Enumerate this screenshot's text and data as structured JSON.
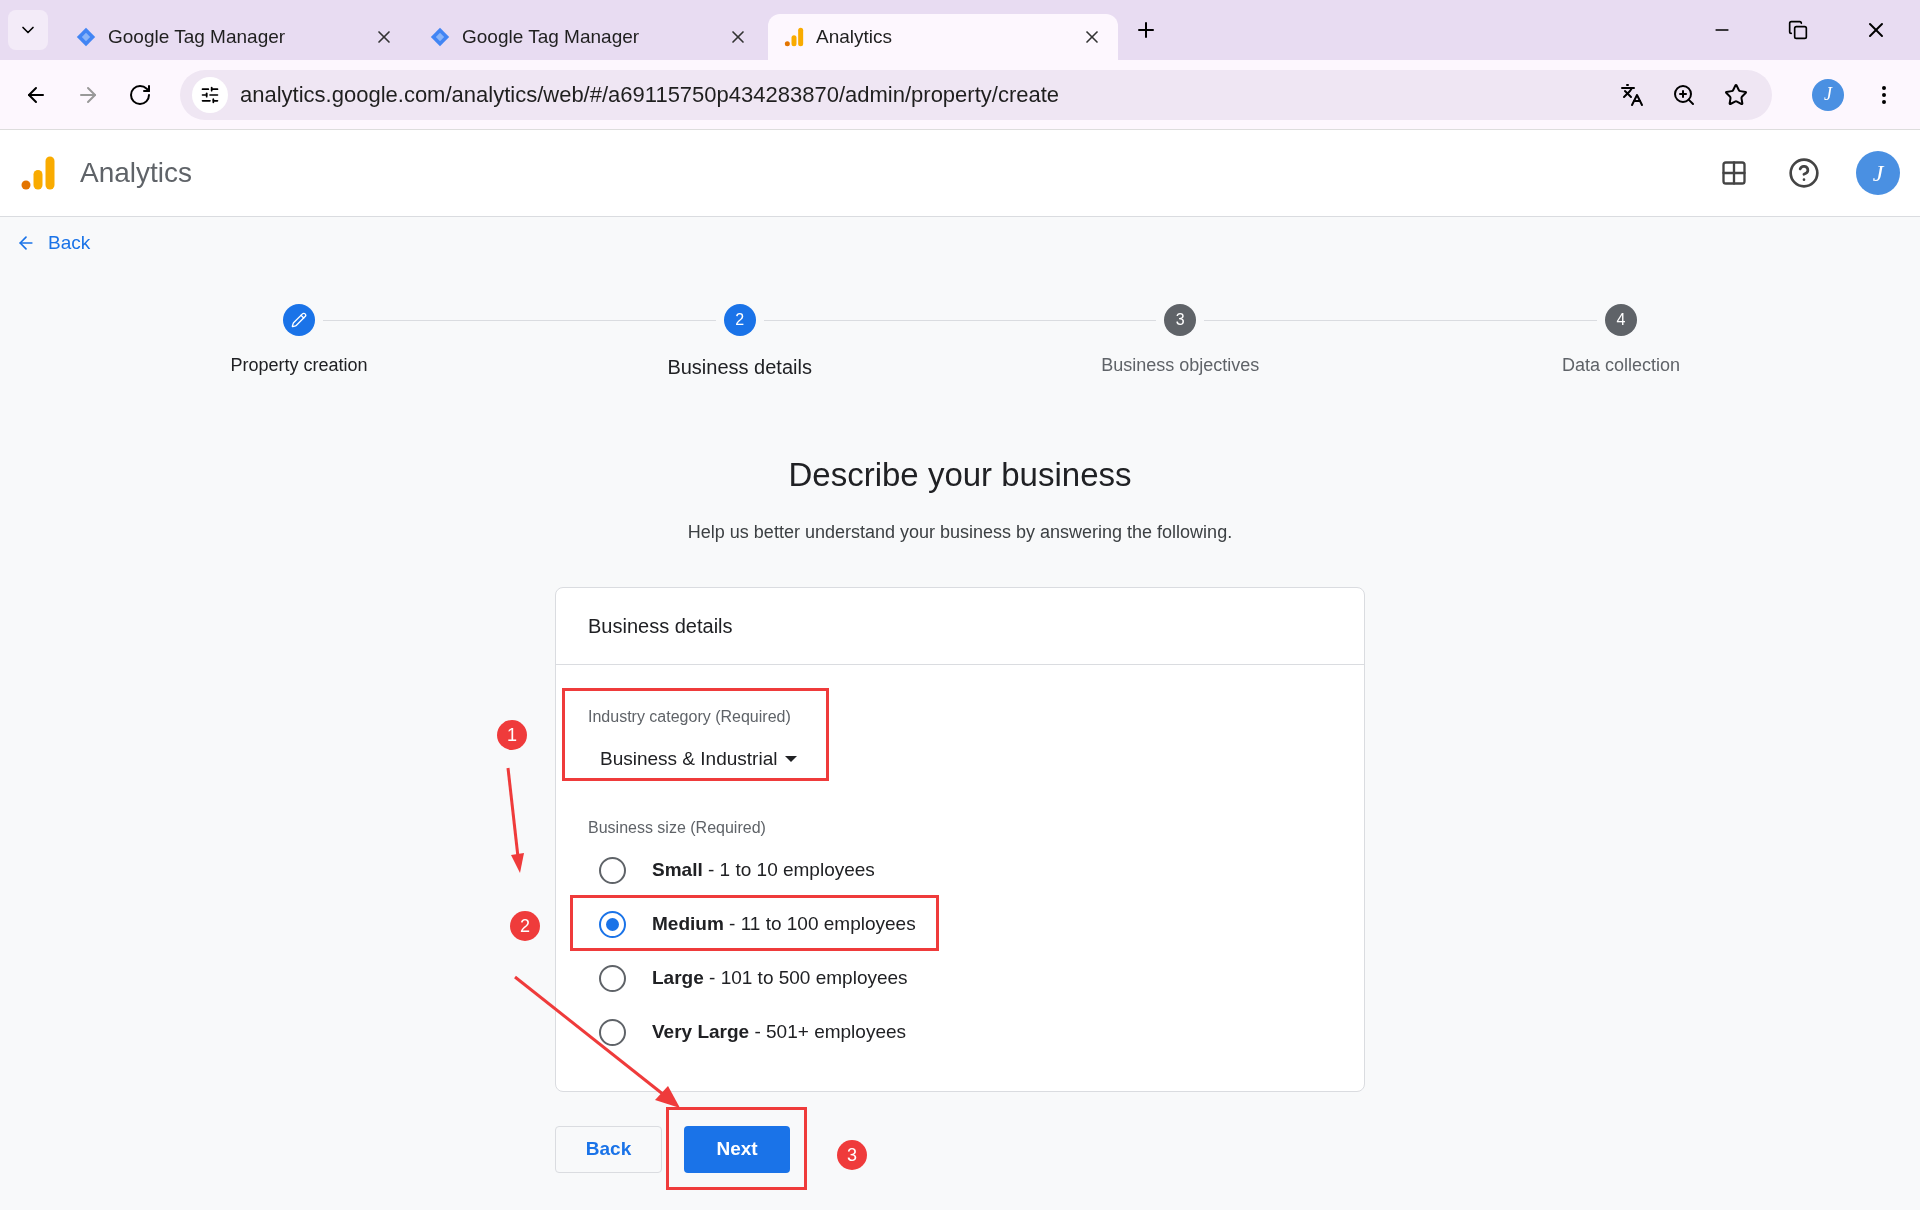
{
  "browser": {
    "tabs": [
      {
        "title": "Google Tag Manager",
        "kind": "diamond",
        "selected": false
      },
      {
        "title": "Google Tag Manager",
        "kind": "diamond",
        "selected": false
      },
      {
        "title": "Analytics",
        "kind": "bars",
        "selected": true
      }
    ],
    "url": "analytics.google.com/analytics/web/#/a69115750p434283870/admin/property/create",
    "profile_avatar": "J"
  },
  "app": {
    "title": "Analytics",
    "avatar": "J"
  },
  "back_link": "Back",
  "steps": [
    {
      "label": "Property creation",
      "completed": true,
      "selected": false
    },
    {
      "label": "Business details",
      "number": "2",
      "completed": false,
      "selected": true
    },
    {
      "label": "Business objectives",
      "number": "3",
      "completed": false,
      "selected": false
    },
    {
      "label": "Data collection",
      "number": "4",
      "completed": false,
      "selected": false
    }
  ],
  "heading": "Describe your business",
  "subheading": "Help us better understand your business by answering the following.",
  "card": {
    "title": "Business details",
    "industry": {
      "label": "Industry category (Required)",
      "value": "Business & Industrial"
    },
    "size": {
      "label": "Business size (Required)",
      "options": [
        {
          "name": "Small",
          "detail": " - 1 to 10 employees",
          "selected": false
        },
        {
          "name": "Medium",
          "detail": " - 11 to 100 employees",
          "selected": true
        },
        {
          "name": "Large",
          "detail": " - 101 to 500 employees",
          "selected": false
        },
        {
          "name": "Very Large",
          "detail": " - 501+ employees",
          "selected": false
        }
      ]
    }
  },
  "buttons": {
    "back": "Back",
    "next": "Next"
  },
  "annotations": [
    "1",
    "2",
    "3"
  ]
}
